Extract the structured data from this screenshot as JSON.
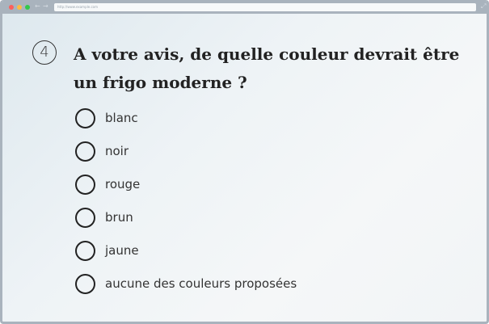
{
  "browser": {
    "url": "http://www.example.com",
    "controls": {
      "close_color": "#fc605c",
      "minimize_color": "#fdbc40",
      "maximize_color": "#34c84a"
    },
    "back_icon": "←",
    "forward_icon": "→",
    "expand_icon": "⤢"
  },
  "question": {
    "number": "4",
    "text": "A votre avis, de quelle couleur devrait être un frigo moderne ?"
  },
  "options": [
    {
      "label": "blanc",
      "selected": false
    },
    {
      "label": "noir",
      "selected": false
    },
    {
      "label": "rouge",
      "selected": false
    },
    {
      "label": "brun",
      "selected": false
    },
    {
      "label": "jaune",
      "selected": false
    },
    {
      "label": "aucune des couleurs proposées",
      "selected": false
    }
  ]
}
